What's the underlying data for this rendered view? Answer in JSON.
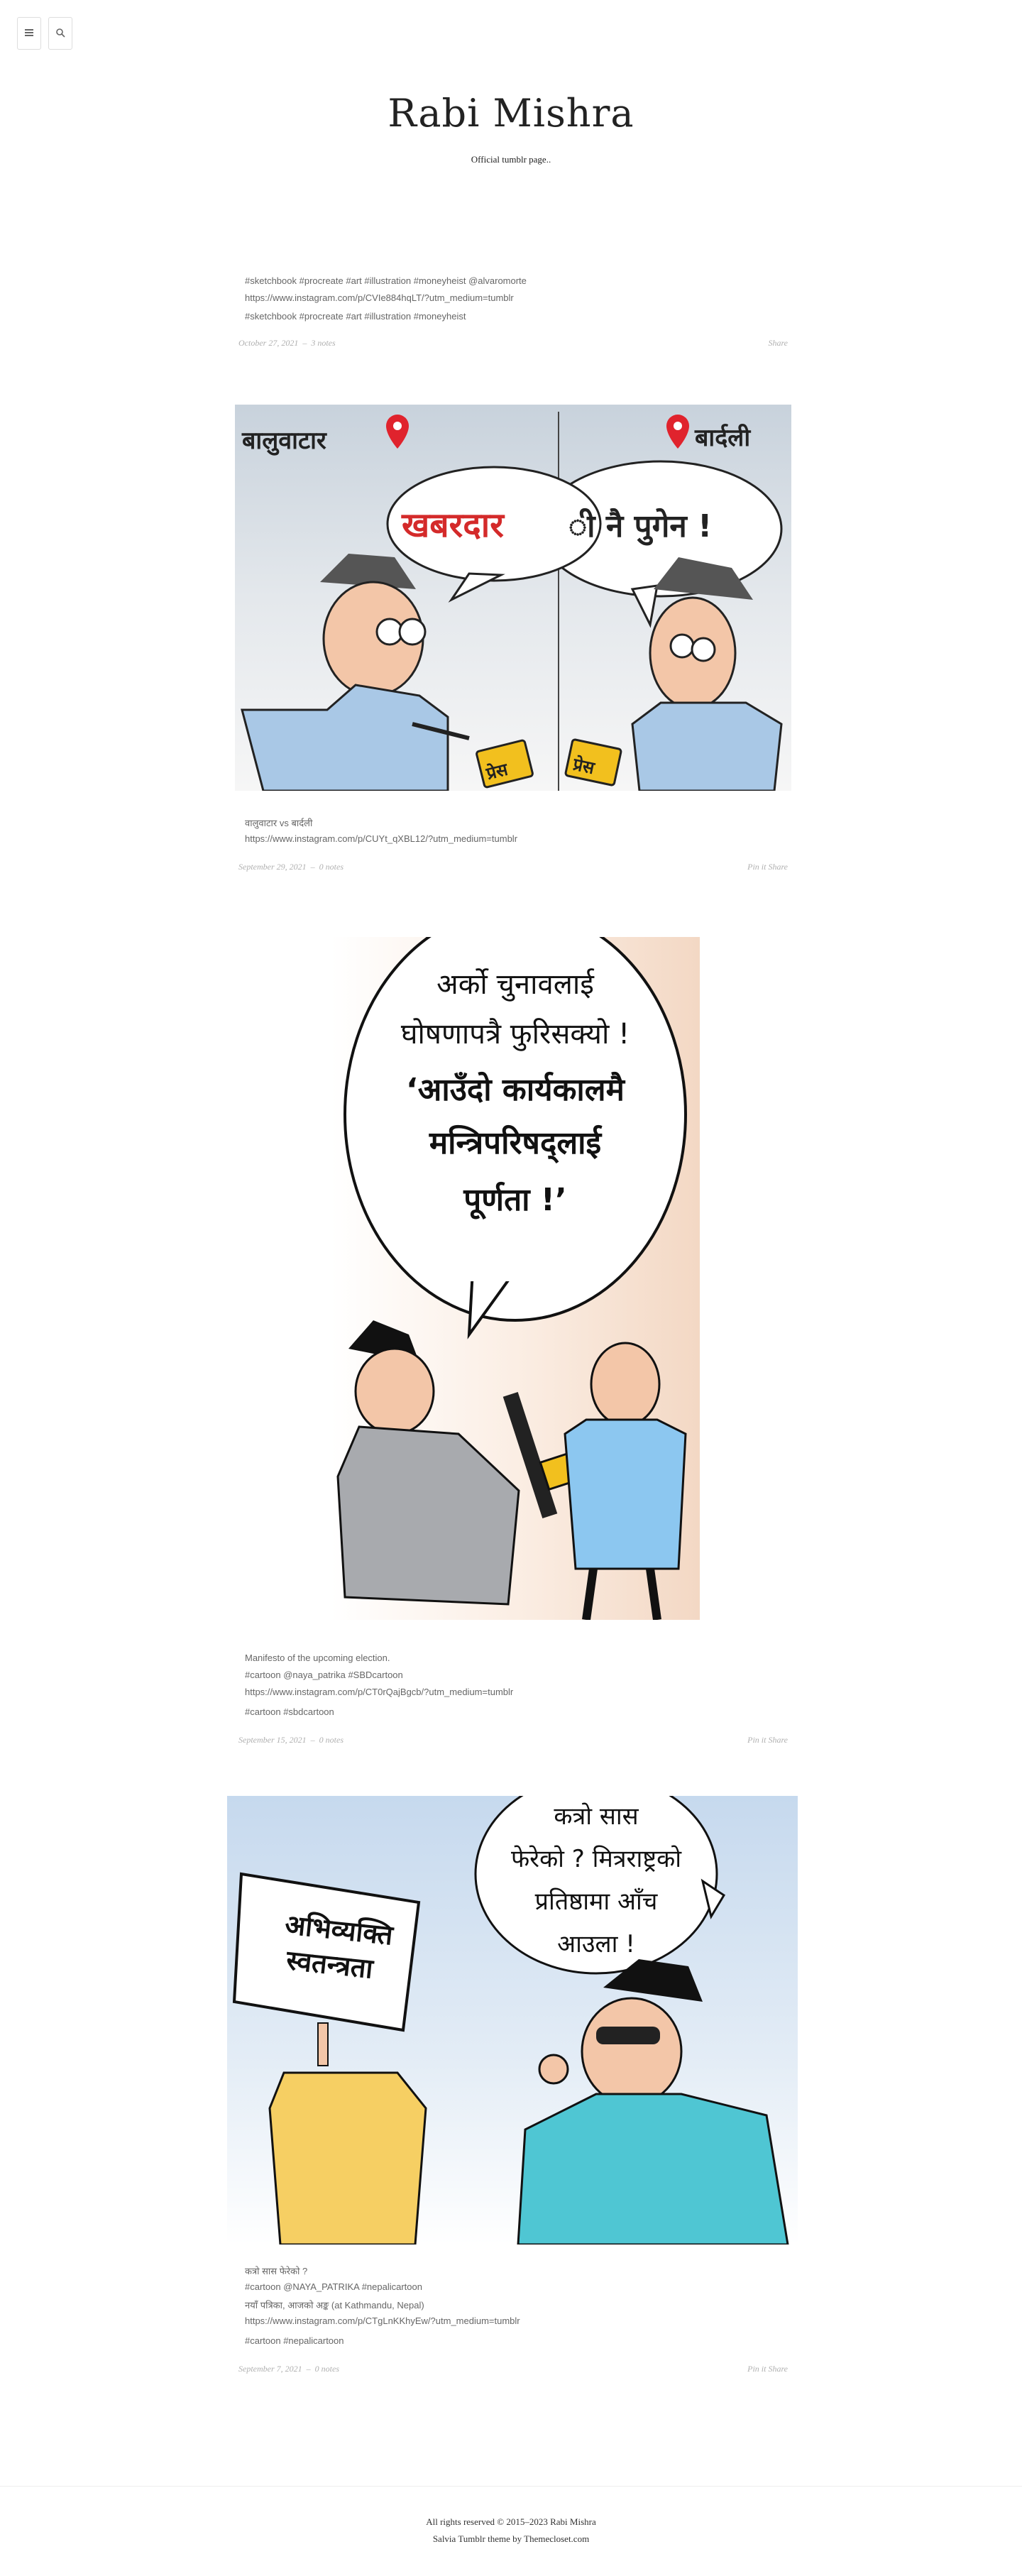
{
  "header": {
    "title": "Rabi Mishra",
    "description": "Official tumblr page.."
  },
  "top_icons": [
    "menu-icon",
    "search-icon"
  ],
  "posts": [
    {
      "captions": [
        "#sketchbook #procreate #art #illustration #moneyheist @alvaromorte",
        "https://www.instagram.com/p/CVIe884hqLT/?utm_medium=tumblr"
      ],
      "tags": "#sketchbook   #procreate   #art   #illustration   #moneyheist",
      "date": "October 27, 2021",
      "notes": "3 notes",
      "actions": "Share"
    },
    {
      "image": {
        "left_location": "बालुवाटार",
        "right_location": "बार्दली",
        "bubble_left": "खबरदार",
        "bubble_right": "ी नै पुगेन !",
        "mic_left": "प्रेस",
        "mic_right": "प्रेस"
      },
      "captions": [
        "वालुवाटार vs बार्दली",
        "https://www.instagram.com/p/CUYt_qXBL12/?utm_medium=tumblr"
      ],
      "date": "September 29, 2021",
      "notes": "0 notes",
      "actions": "Pin it   Share"
    },
    {
      "image": {
        "line1": "अर्को चुनावलाई",
        "line2": "घोषणापत्रै फुरिसक्यो !",
        "line3": "‘आउँदो कार्यकालमै",
        "line4": "मन्त्रिपरिषद्लाई",
        "line5": "पूर्णता !’"
      },
      "captions": [
        "Manifesto of the upcoming election.",
        "#cartoon @naya_patrika #SBDcartoon",
        "https://www.instagram.com/p/CT0rQajBgcb/?utm_medium=tumblr"
      ],
      "tags": "#cartoon   #sbdcartoon",
      "date": "September 15, 2021",
      "notes": "0 notes",
      "actions": "Pin it   Share"
    },
    {
      "image": {
        "line1": "कत्रो सास",
        "line2": "फेरेको ? मित्रराष्ट्रको",
        "line3": "प्रतिष्ठामा आँच",
        "line4": "आउला !",
        "sign_line1": "अभिव्यक्ति",
        "sign_line2": "स्वतन्त्रता"
      },
      "captions": [
        "कत्रो सास फेरेको ?",
        "#cartoon @NAYA_PATRIKA #nepalicartoon",
        "नयाँ पत्रिका, आजको अङ्क (at Kathmandu, Nepal)",
        "https://www.instagram.com/p/CTgLnKKhyEw/?utm_medium=tumblr"
      ],
      "tags": "#cartoon   #nepalicartoon",
      "date": "September 7, 2021",
      "notes": "0 notes",
      "actions": "Pin it   Share"
    }
  ],
  "footer": {
    "line1": "All rights reserved © 2015–2023 Rabi Mishra",
    "line2": "Salvia Tumblr theme by Themecloset.com"
  },
  "colors": {
    "accent_red": "#d42a2a",
    "sky_blue": "#b8d3ea",
    "cap_gray": "#e6e6e6"
  }
}
